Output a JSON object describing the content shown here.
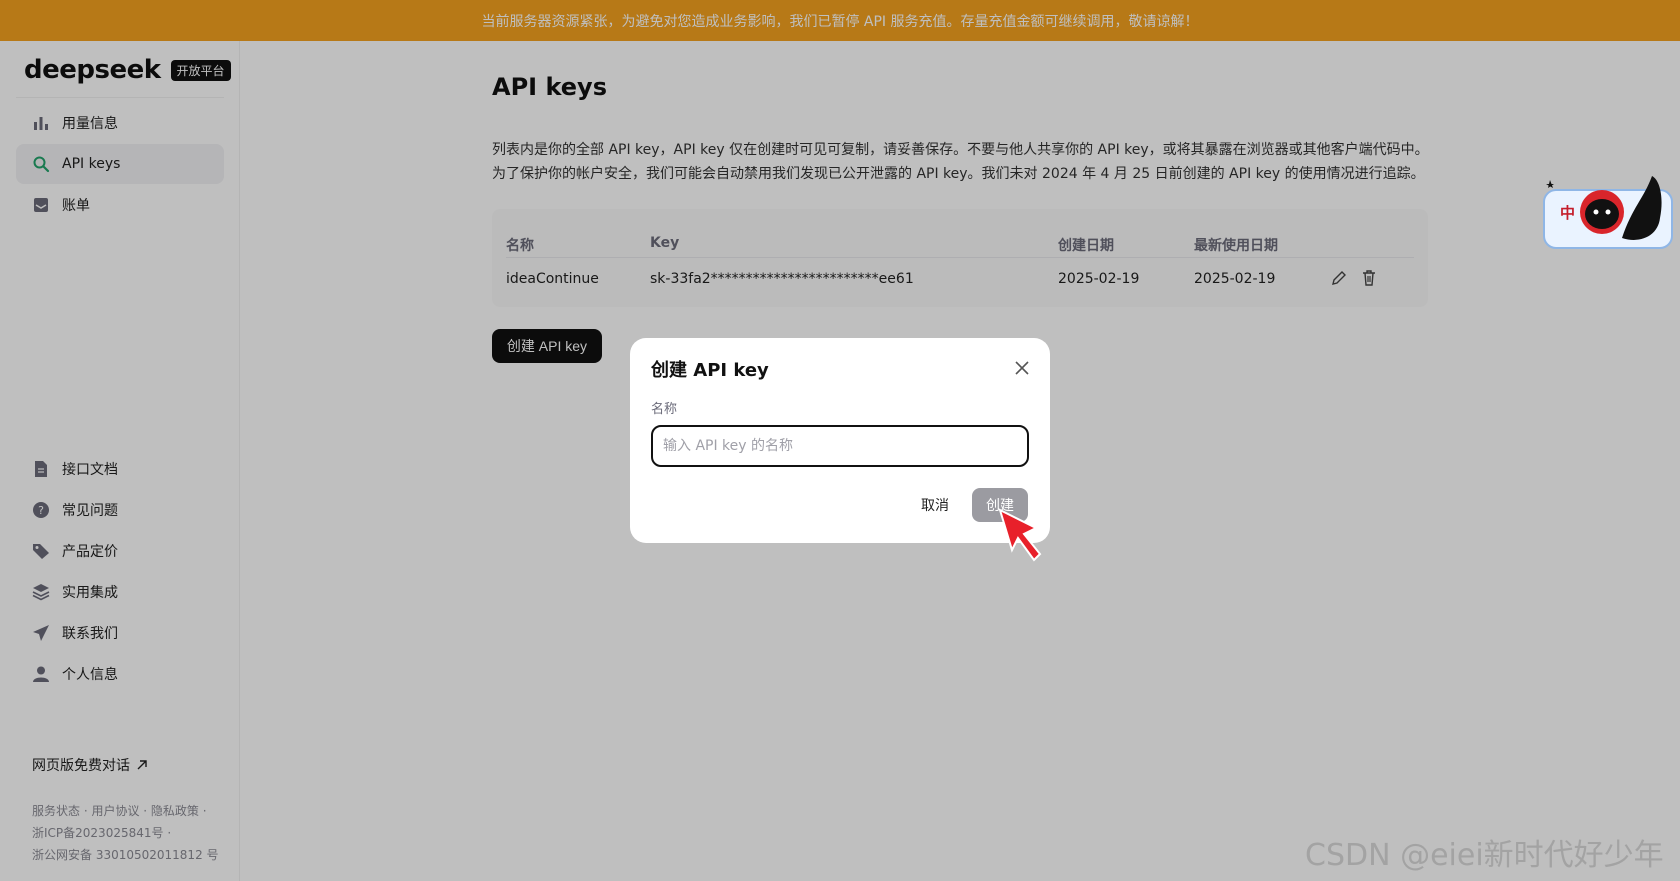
{
  "banner": {
    "text": "当前服务器资源紧张，为避免对您造成业务影响，我们已暂停 API 服务充值。存量充值金额可继续调用，敬请谅解！"
  },
  "brand": {
    "name": "deepseek",
    "tag": "开放平台"
  },
  "sidebar": {
    "top_items": [
      {
        "label": "用量信息",
        "icon": "bar-chart-icon"
      },
      {
        "label": "API keys",
        "icon": "search-icon",
        "active": true
      },
      {
        "label": "账单",
        "icon": "inbox-icon"
      }
    ],
    "bottom_items": [
      {
        "label": "接口文档",
        "icon": "document-icon"
      },
      {
        "label": "常见问题",
        "icon": "help-icon"
      },
      {
        "label": "产品定价",
        "icon": "tag-icon"
      },
      {
        "label": "实用集成",
        "icon": "layers-icon"
      },
      {
        "label": "联系我们",
        "icon": "send-icon"
      },
      {
        "label": "个人信息",
        "icon": "user-icon"
      }
    ],
    "web_chat": "网页版免费对话",
    "footer": [
      "服务状态 · 用户协议 · 隐私政策 ·",
      "浙ICP备2023025841号 ·",
      "浙公网安备 33010502011812 号"
    ]
  },
  "main": {
    "title": "API keys",
    "desc_line1": "列表内是你的全部 API key，API key 仅在创建时可见可复制，请妥善保存。不要与他人共享你的 API key，或将其暴露在浏览器或其他客户端代码中。",
    "desc_line2": "为了保护你的帐户安全，我们可能会自动禁用我们发现已公开泄露的 API key。我们未对 2024 年 4 月 25 日前创建的 API key 的使用情况进行追踪。",
    "table": {
      "headers": {
        "name": "名称",
        "key": "Key",
        "created": "创建日期",
        "last_used": "最新使用日期"
      },
      "rows": [
        {
          "name": "ideaContinue",
          "key": "sk-33fa2************************ee61",
          "created": "2025-02-19",
          "last_used": "2025-02-19"
        }
      ]
    },
    "create_button": "创建 API key"
  },
  "modal": {
    "title": "创建 API key",
    "label": "名称",
    "input_value": "",
    "input_placeholder": "输入 API key 的名称",
    "cancel": "取消",
    "create": "创建"
  },
  "watermark": "CSDN @eiei新时代好少年",
  "colors": {
    "banner": "#f4a21f",
    "active_icon": "#22a36b",
    "primary_button": "#111111",
    "disabled_button": "#9b9ba1"
  }
}
